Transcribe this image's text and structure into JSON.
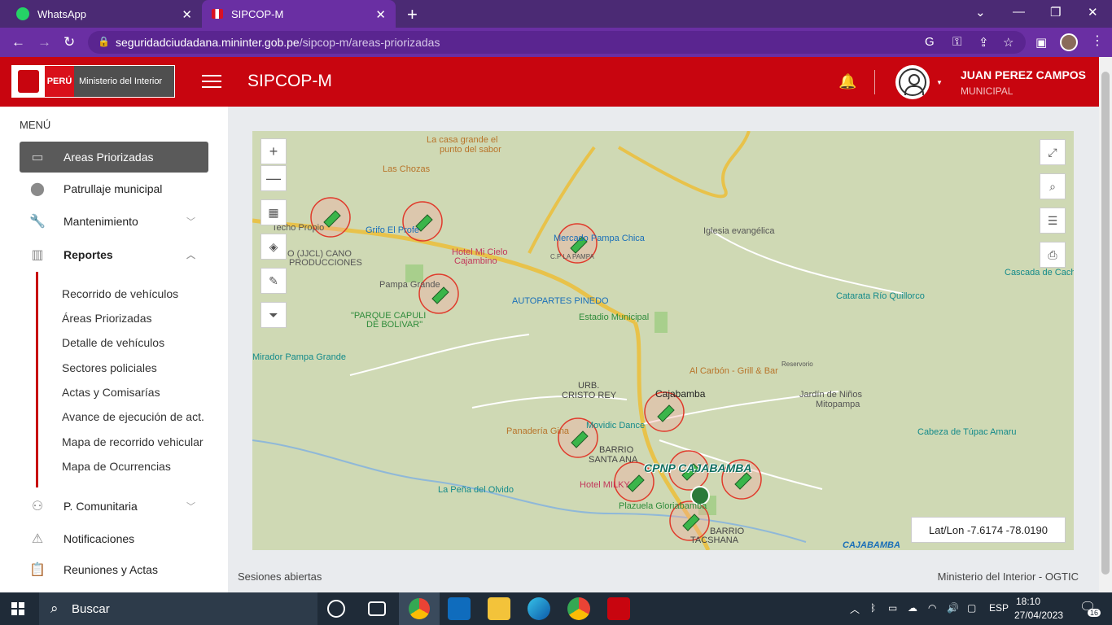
{
  "browser": {
    "tabs": [
      {
        "label": "WhatsApp",
        "icon": "whatsapp-icon",
        "active": false
      },
      {
        "label": "SIPCOP-M",
        "icon": "peru-flag-icon",
        "active": true
      }
    ],
    "url_host": "seguridadciudadana.mininter.gob.pe",
    "url_path": "/sipcop-m/areas-priorizadas"
  },
  "header": {
    "logo_country": "PERÚ",
    "logo_ministry": "Ministerio del Interior",
    "app_title": "SIPCOP-M",
    "user_name": "JUAN PEREZ CAMPOS",
    "user_role": "MUNICIPAL"
  },
  "sidebar": {
    "menu_label": "MENÚ",
    "items": [
      {
        "label": "Areas Priorizadas",
        "icon": "map-screen-icon",
        "active": true
      },
      {
        "label": "Patrullaje municipal",
        "icon": "location-pin-icon"
      },
      {
        "label": "Mantenimiento",
        "icon": "wrench-icon",
        "expandable": true
      },
      {
        "label": "Reportes",
        "icon": "bar-chart-icon",
        "expanded": true
      }
    ],
    "reportes_sub": [
      "Recorrido de vehículos",
      "Áreas Priorizadas",
      "Detalle de vehículos",
      "Sectores policiales",
      "Actas y Comisarías",
      "Avance de ejecución de act.",
      "Mapa de recorrido vehicular",
      "Mapa de Ocurrencias"
    ],
    "bottom_items": [
      {
        "label": "P. Comunitaria",
        "icon": "community-icon",
        "expandable": true
      },
      {
        "label": "Notificaciones",
        "icon": "alarm-icon"
      },
      {
        "label": "Reuniones y Actas",
        "icon": "clipboard-icon"
      }
    ]
  },
  "map": {
    "latlon_label": "Lat/Lon -7.6174 -78.0190",
    "cpnp_label": "CPNP CAJABAMBA",
    "places": [
      {
        "text": "La casa grande el",
        "color": "#b8742a"
      },
      {
        "text": "punto del sabor",
        "color": "#b8742a"
      },
      {
        "text": "Las Chozas",
        "color": "#b8742a"
      },
      {
        "text": "Techo Propio",
        "color": "#555"
      },
      {
        "text": "Grifo El Profe",
        "color": "#1a6fb8"
      },
      {
        "text": "IO (JJCL) CANO",
        "color": "#555"
      },
      {
        "text": "PRODUCCIONES",
        "color": "#555"
      },
      {
        "text": "Hotel Mi Cielo",
        "color": "#c2365a"
      },
      {
        "text": "Cajambino",
        "color": "#c2365a"
      },
      {
        "text": "Mercado Pampa Chica",
        "color": "#1a6fb8"
      },
      {
        "text": "C.P LA PAMPA",
        "color": "#555"
      },
      {
        "text": "Iglesia evangélica",
        "color": "#555"
      },
      {
        "text": "Pampa Grande",
        "color": "#555"
      },
      {
        "text": "\"PARQUE CAPULI",
        "color": "#2e8b3a"
      },
      {
        "text": "DE BOLIVAR\"",
        "color": "#2e8b3a"
      },
      {
        "text": "AUTOPARTES PINEDO",
        "color": "#1a6fb8"
      },
      {
        "text": "Estadio Municipal",
        "color": "#2e8b3a"
      },
      {
        "text": "Catarata Río Quillorco",
        "color": "#138a8a"
      },
      {
        "text": "Cascada de Cach",
        "color": "#138a8a"
      },
      {
        "text": "Mirador Pampa Grande",
        "color": "#138a8a"
      },
      {
        "text": "Al Carbón - Grill & Bar",
        "color": "#b8742a"
      },
      {
        "text": "Reservorio",
        "color": "#555"
      },
      {
        "text": "URB.",
        "color": "#444"
      },
      {
        "text": "CRISTO REY",
        "color": "#444"
      },
      {
        "text": "Cajabamba",
        "color": "#222"
      },
      {
        "text": "Jardín de Niños",
        "color": "#555"
      },
      {
        "text": "Mitopampa",
        "color": "#555"
      },
      {
        "text": "Panadería Gina",
        "color": "#b8742a"
      },
      {
        "text": "Movidic Dance",
        "color": "#138a8a"
      },
      {
        "text": "BARRIO",
        "color": "#444"
      },
      {
        "text": "SANTA ANA",
        "color": "#444"
      },
      {
        "text": "Cabeza de Túpac Amaru",
        "color": "#138a8a"
      },
      {
        "text": "La Peña del Olvido",
        "color": "#138a8a"
      },
      {
        "text": "Hotel MILKY",
        "color": "#c2365a"
      },
      {
        "text": "Plazuela Gloriabamba",
        "color": "#2e8b3a"
      },
      {
        "text": "BARRIO",
        "color": "#444"
      },
      {
        "text": "TACSHANA",
        "color": "#444"
      },
      {
        "text": "CAJABAMBA",
        "color": "#1a6fb8"
      }
    ]
  },
  "footer": {
    "left": "Sesiones abiertas",
    "right": "Ministerio del Interior - OGTIC"
  },
  "taskbar": {
    "search_label": "Buscar",
    "lang": "ESP",
    "time": "18:10",
    "date": "27/04/2023",
    "notifications": "16"
  }
}
